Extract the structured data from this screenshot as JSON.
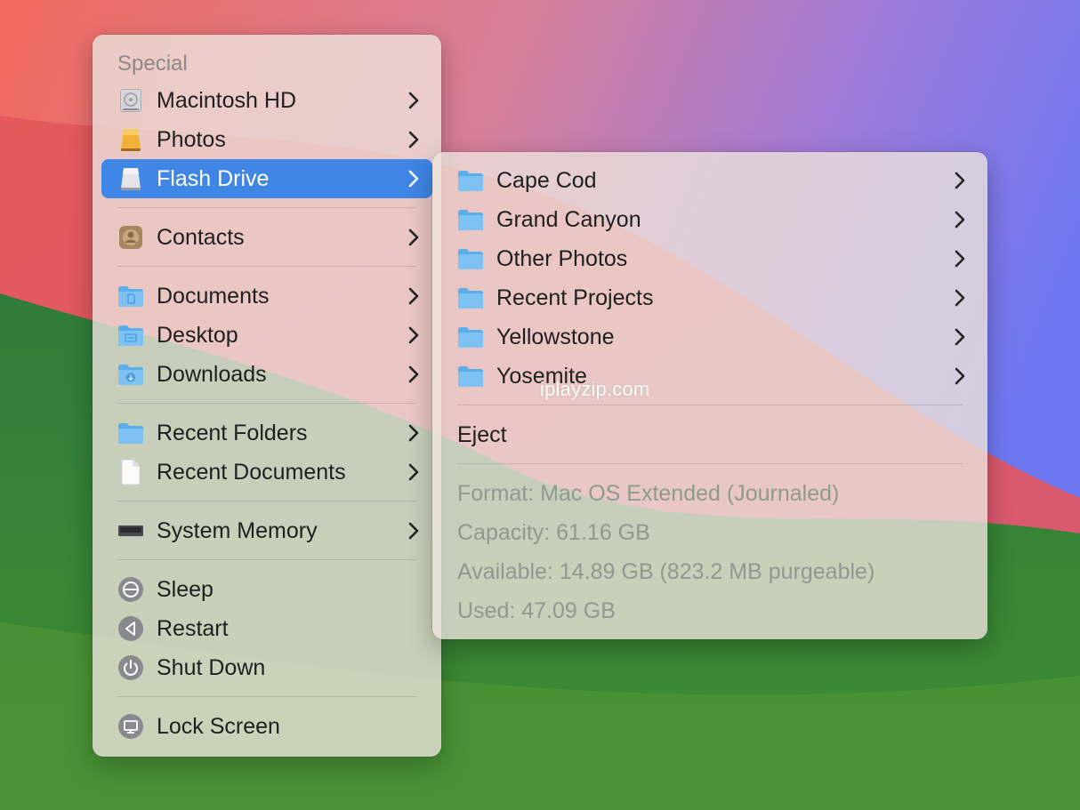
{
  "main_menu": {
    "section_header": "Special",
    "items": {
      "macintosh_hd": "Macintosh HD",
      "photos": "Photos",
      "flash_drive": "Flash Drive",
      "contacts": "Contacts",
      "documents": "Documents",
      "desktop": "Desktop",
      "downloads": "Downloads",
      "recent_folders": "Recent Folders",
      "recent_documents": "Recent Documents",
      "system_memory": "System Memory",
      "sleep": "Sleep",
      "restart": "Restart",
      "shut_down": "Shut Down",
      "lock_screen": "Lock Screen"
    },
    "selected_item": "Flash Drive"
  },
  "submenu": {
    "folders": [
      "Cape Cod",
      "Grand Canyon",
      "Other Photos",
      "Recent Projects",
      "Yellowstone",
      "Yosemite"
    ],
    "eject": "Eject",
    "info": {
      "format": "Format: Mac OS Extended (Journaled)",
      "capacity": "Capacity: 61.16 GB",
      "available": "Available: 14.89 GB (823.2 MB purgeable)",
      "used": "Used: 47.09 GB"
    }
  },
  "watermark": "iplayzip.com",
  "colors": {
    "selection": "#3f86e6",
    "folder": "#5eb3ef",
    "info_text": "#8f9a8e"
  }
}
